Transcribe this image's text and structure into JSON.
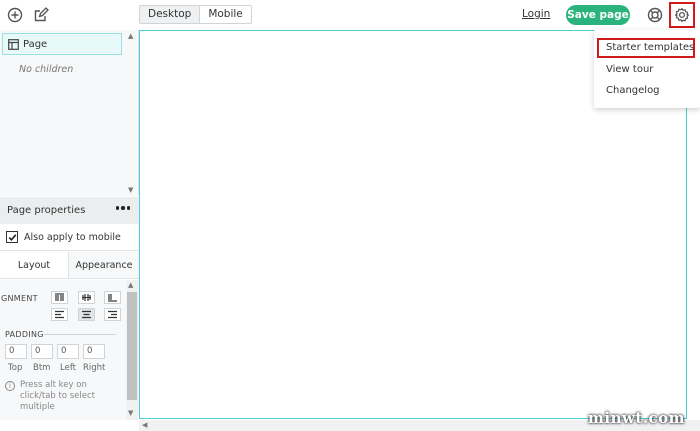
{
  "toolbar": {
    "add_icon": "plus-circle-icon",
    "edit_icon": "edit-icon",
    "view_modes": [
      "Desktop",
      "Mobile"
    ],
    "active_view": "Desktop",
    "login_label": "Login",
    "save_label": "Save page",
    "help_icon": "lifebuoy-icon",
    "settings_icon": "gear-icon",
    "save_color": "#2ab37c",
    "highlight_color": "#d11a1a"
  },
  "layers": {
    "page_label": "Page",
    "empty_label": "No children"
  },
  "properties": {
    "title": "Page properties",
    "apply_mobile_label": "Also apply to mobile",
    "apply_mobile_checked": true,
    "tabs": [
      "Layout",
      "Appearance"
    ],
    "active_tab": "Layout",
    "alignment_label": "GNMENT",
    "padding_label": "PADDING",
    "padding": [
      {
        "label": "Top",
        "value": "0"
      },
      {
        "label": "Btm",
        "value": "0"
      },
      {
        "label": "Left",
        "value": "0"
      },
      {
        "label": "Right",
        "value": "0"
      }
    ],
    "hint": "Press alt key on click/tab to select multiple"
  },
  "settings_menu": {
    "items": [
      "Starter templates",
      "View tour",
      "Changelog"
    ],
    "highlighted": "Starter templates"
  },
  "watermark": "minwt.com"
}
